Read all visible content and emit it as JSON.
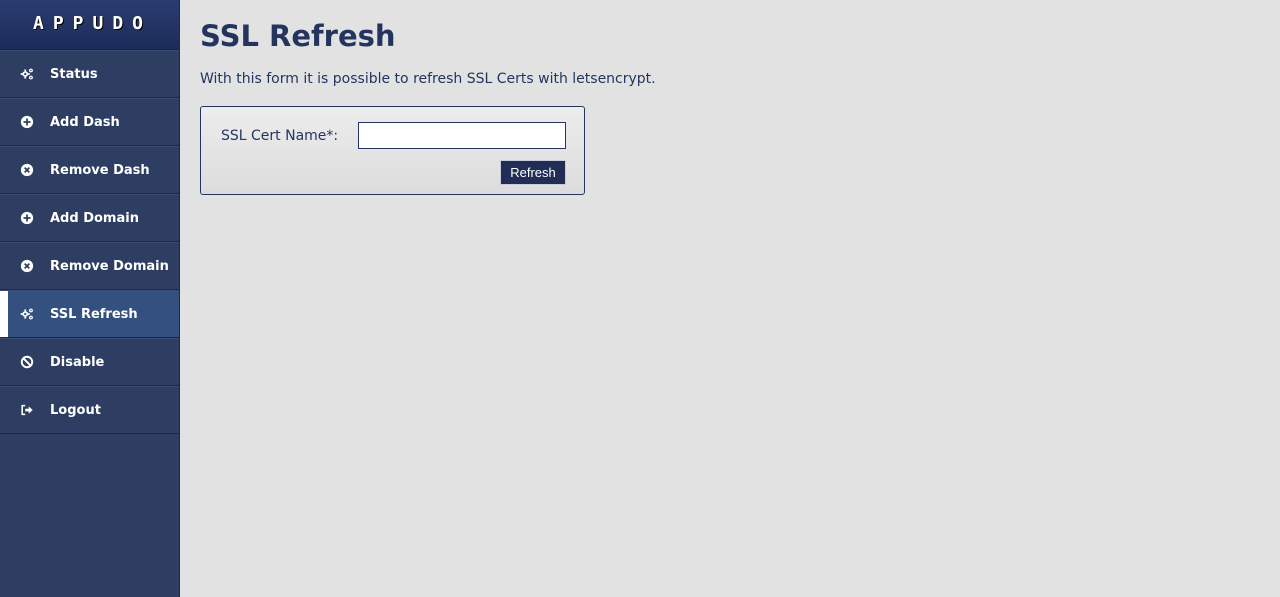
{
  "brand": {
    "name": "APPUDO"
  },
  "sidebar": {
    "items": [
      {
        "label": "Status",
        "icon": "cogs-icon"
      },
      {
        "label": "Add Dash",
        "icon": "plus-circle-icon"
      },
      {
        "label": "Remove Dash",
        "icon": "times-circle-icon"
      },
      {
        "label": "Add Domain",
        "icon": "plus-circle-icon"
      },
      {
        "label": "Remove Domain",
        "icon": "times-circle-icon"
      },
      {
        "label": "SSL Refresh",
        "icon": "cogs-icon",
        "active": true
      },
      {
        "label": "Disable",
        "icon": "ban-icon"
      },
      {
        "label": "Logout",
        "icon": "sign-out-icon"
      }
    ]
  },
  "main": {
    "title": "SSL Refresh",
    "description": "With this form it is possible to refresh SSL Certs with letsencrypt.",
    "form": {
      "field_label": "SSL Cert Name*:",
      "field_value": "",
      "field_placeholder": "",
      "submit_label": "Refresh"
    }
  },
  "colors": {
    "sidebar_bg": "#2d3e62",
    "sidebar_active": "#34507f",
    "accent": "#23355f",
    "page_bg": "#e2e2e2"
  }
}
